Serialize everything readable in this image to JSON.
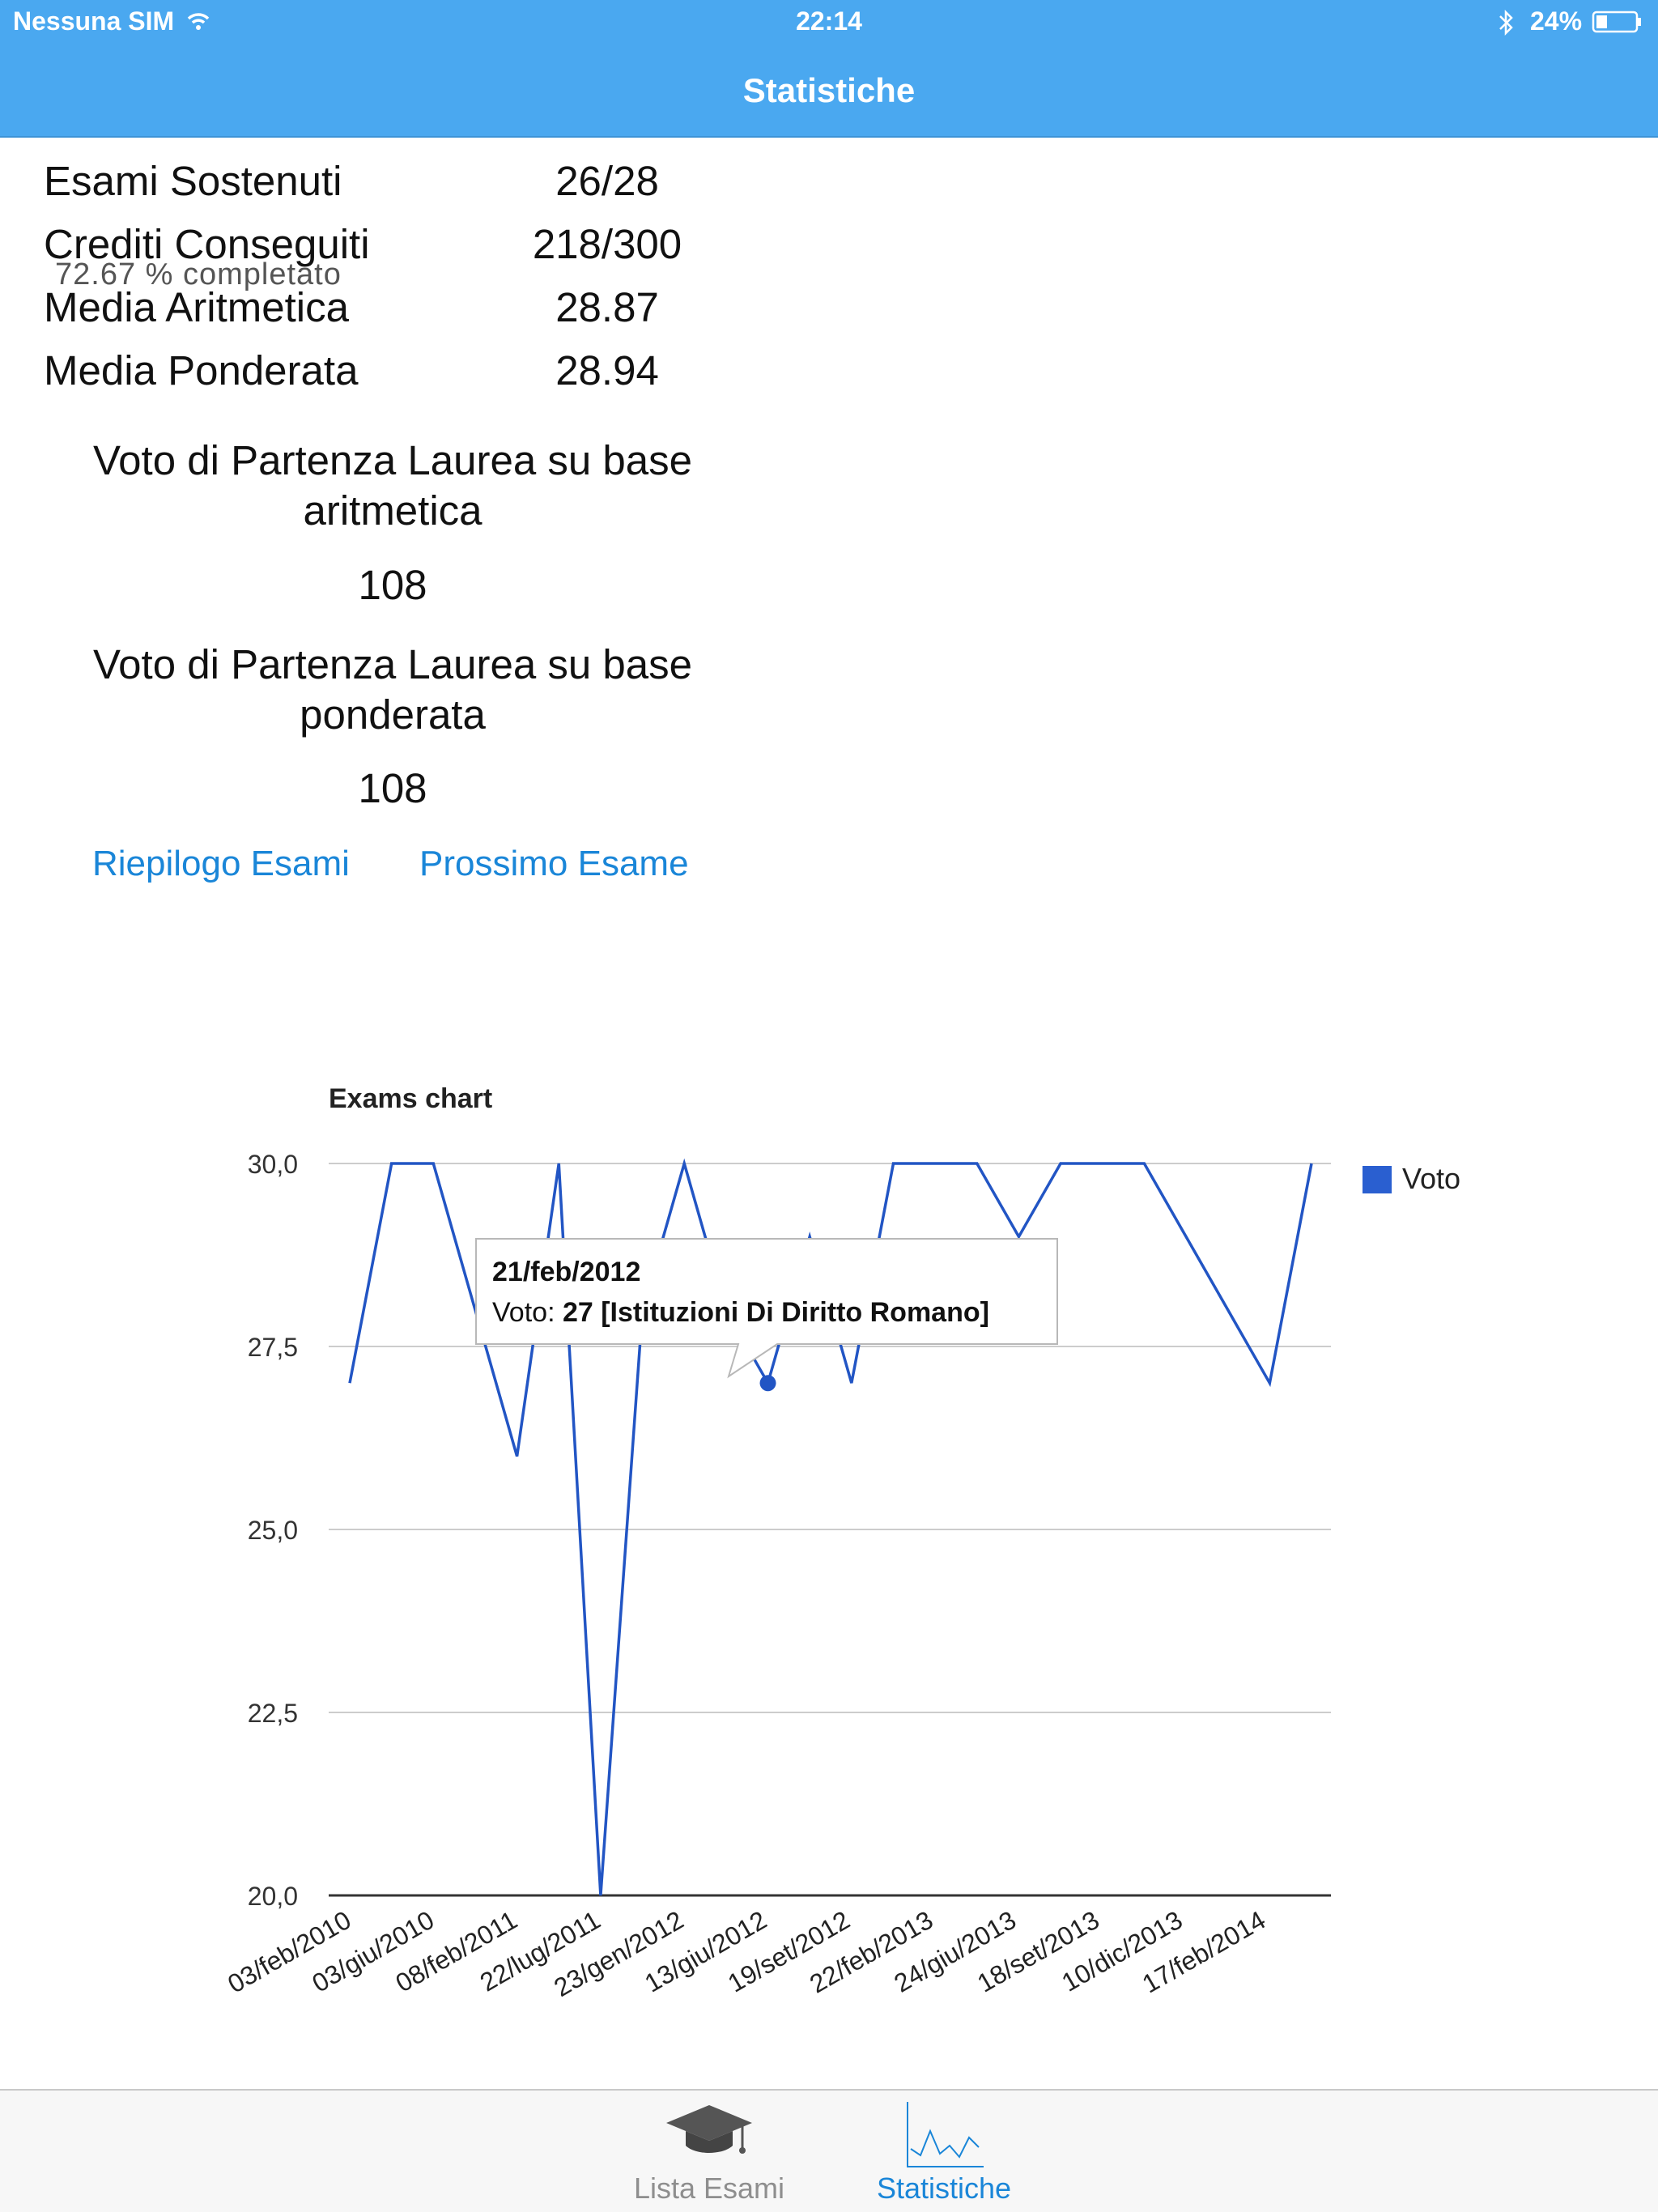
{
  "status_bar": {
    "carrier": "Nessuna SIM",
    "time": "22:14",
    "battery": "24%",
    "wifi_icon": "wifi-icon",
    "bluetooth_icon": "bluetooth-icon",
    "battery_icon": "battery-icon"
  },
  "nav": {
    "title": "Statistiche"
  },
  "stats": {
    "exams_label": "Esami Sostenuti",
    "exams_value": "26/28",
    "credits_label": "Crediti Conseguiti",
    "credits_value": "218/300",
    "progress_note": "72.67 % completato",
    "arith_label": "Media Aritmetica",
    "arith_value": "28.87",
    "weighted_label": "Media Ponderata",
    "weighted_value": "28.94"
  },
  "degree": {
    "arith_title": "Voto di Partenza Laurea su base aritmetica",
    "arith_vote": "108",
    "weighted_title": "Voto di Partenza Laurea su base ponderata",
    "weighted_vote": "108"
  },
  "links": {
    "summary": "Riepilogo Esami",
    "next": "Prossimo Esame"
  },
  "tooltip": {
    "date": "21/feb/2012",
    "series_label": "Voto:",
    "value_text": "27 [Istituzioni Di Diritto Romano]"
  },
  "chart_data": {
    "type": "line",
    "title": "Exams chart",
    "xlabel": "",
    "ylabel": "",
    "ylim": [
      20,
      30
    ],
    "y_ticks": [
      "30,0",
      "27,5",
      "25,0",
      "22,5",
      "20,0"
    ],
    "y_tick_values": [
      30,
      27.5,
      25,
      22.5,
      20
    ],
    "x_tick_labels": [
      "03/feb/2010",
      "03/giu/2010",
      "08/feb/2011",
      "22/lug/2011",
      "23/gen/2012",
      "13/giu/2012",
      "19/set/2012",
      "22/feb/2013",
      "24/giu/2013",
      "18/set/2013",
      "10/dic/2013",
      "17/feb/2014"
    ],
    "legend": "right",
    "grid": true,
    "color": "#2255c4",
    "series": [
      {
        "name": "Voto",
        "values": [
          27,
          30,
          30,
          28,
          26,
          30,
          20,
          28,
          30,
          28,
          27,
          29,
          27,
          30,
          30,
          30,
          29,
          30,
          30,
          30,
          29,
          28,
          27,
          30
        ]
      }
    ],
    "highlight_index": 10
  },
  "tabs": [
    {
      "label": "Lista Esami",
      "icon": "graduation-cap-icon"
    },
    {
      "label": "Statistiche",
      "icon": "chart-icon"
    }
  ]
}
